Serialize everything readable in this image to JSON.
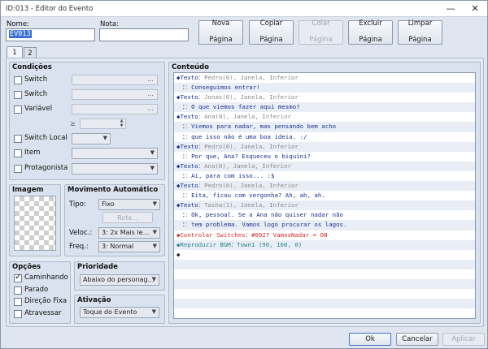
{
  "window": {
    "title": "ID:013 - Editor do Evento",
    "minimize": "—",
    "close": "✕"
  },
  "header": {
    "name_label": "Nome:",
    "name_value": "EV013",
    "note_label": "Nota:",
    "note_value": ""
  },
  "page_buttons": [
    {
      "line1": "Nova",
      "line2": "Página",
      "enabled": true
    },
    {
      "line1": "Copiar",
      "line2": "Página",
      "enabled": true
    },
    {
      "line1": "Colar",
      "line2": "Página",
      "enabled": false
    },
    {
      "line1": "Excluir",
      "line2": "Página",
      "enabled": true
    },
    {
      "line1": "Limpar",
      "line2": "Página",
      "enabled": true
    }
  ],
  "tabs": [
    "1",
    "2"
  ],
  "conditions": {
    "title": "Condições",
    "items": [
      {
        "label": "Switch",
        "type": "dots"
      },
      {
        "label": "Switch",
        "type": "dots"
      },
      {
        "label": "Variável",
        "type": "dots"
      },
      {
        "label": "Switch Local",
        "type": "combo"
      },
      {
        "label": "Item",
        "type": "combo"
      },
      {
        "label": "Protagonista",
        "type": "combo"
      }
    ],
    "gte": "≥",
    "dots": "..."
  },
  "image": {
    "title": "Imagem"
  },
  "movement": {
    "title": "Movimento Automático",
    "type_label": "Tipo:",
    "type_value": "Fixo",
    "route_button": "Rota...",
    "speed_label": "Veloc.:",
    "speed_value": "3: 2x Mais le…",
    "freq_label": "Freq.:",
    "freq_value": "3: Normal"
  },
  "options": {
    "title": "Opções",
    "items": [
      {
        "label": "Caminhando",
        "checked": true
      },
      {
        "label": "Parado",
        "checked": false
      },
      {
        "label": "Direção Fixa",
        "checked": false
      },
      {
        "label": "Atravessar",
        "checked": false
      }
    ]
  },
  "priority": {
    "title": "Prioridade",
    "value": "Abaixo do personag…"
  },
  "trigger": {
    "title": "Ativação",
    "value": "Toque do Evento"
  },
  "content": {
    "title": "Conteúdo",
    "lines": [
      {
        "prefix": "◆Texto",
        "sep": "：",
        "text": "Pedro(0), Janela, Inferior",
        "color": "gray"
      },
      {
        "prefix": "：",
        "sep": "：",
        "text": "Conseguimos entrar!",
        "color": "blue"
      },
      {
        "prefix": "◆Texto",
        "sep": "：",
        "text": "Jonas(0), Janela, Inferior",
        "color": "gray"
      },
      {
        "prefix": "：",
        "sep": "：",
        "text": "O que viemos fazer aqui mesmo?",
        "color": "blue"
      },
      {
        "prefix": "◆Texto",
        "sep": "：",
        "text": "Ana(0), Janela, Inferior",
        "color": "gray"
      },
      {
        "prefix": "：",
        "sep": "：",
        "text": "Viemos para nadar, mas pensando bem acho",
        "color": "blue"
      },
      {
        "prefix": "：",
        "sep": "：",
        "text": "que isso não é uma boa ideia. :/",
        "color": "blue"
      },
      {
        "prefix": "◆Texto",
        "sep": "：",
        "text": "Pedro(0), Janela, Inferior",
        "color": "gray"
      },
      {
        "prefix": "：",
        "sep": "：",
        "text": "Por que, Ana? Esqueceu o biquíni?",
        "color": "blue"
      },
      {
        "prefix": "◆Texto",
        "sep": "：",
        "text": "Ana(0), Janela, Inferior",
        "color": "gray"
      },
      {
        "prefix": "：",
        "sep": "：",
        "text": "Ai, para com isso... :$",
        "color": "blue"
      },
      {
        "prefix": "◆Texto",
        "sep": "：",
        "text": "Pedro(0), Janela, Inferior",
        "color": "gray"
      },
      {
        "prefix": "：",
        "sep": "：",
        "text": "Eita, ficou com vergonha? Ah, ah, ah.",
        "color": "blue"
      },
      {
        "prefix": "◆Texto",
        "sep": "：",
        "text": "Tasha(1), Janela, Inferior",
        "color": "gray"
      },
      {
        "prefix": "：",
        "sep": "：",
        "text": "Ok, pessoal. Se a Ana não quiser nadar não",
        "color": "blue"
      },
      {
        "prefix": "：",
        "sep": "：",
        "text": "tem problema. Vamos logo procurar os lagos.",
        "color": "blue"
      },
      {
        "prefix": "◆Controlar Switches",
        "sep": "：",
        "text": "#0027 VamosNadar = ON",
        "color": "red"
      },
      {
        "prefix": "◆Reproduzir BGM",
        "sep": "：",
        "text": "Town1 (90, 100, 0)",
        "color": "teal"
      },
      {
        "prefix": "◆",
        "sep": "",
        "text": "",
        "color": "blue"
      }
    ]
  },
  "footer": {
    "ok": "Ok",
    "cancel": "Cancelar",
    "apply": "Aplicar"
  },
  "colors": {
    "accent": "#3d6fd1",
    "text_blue": "#1b2f8f",
    "text_red": "#d12a2a",
    "text_teal": "#27838e",
    "text_gray": "#8a8a8a"
  }
}
